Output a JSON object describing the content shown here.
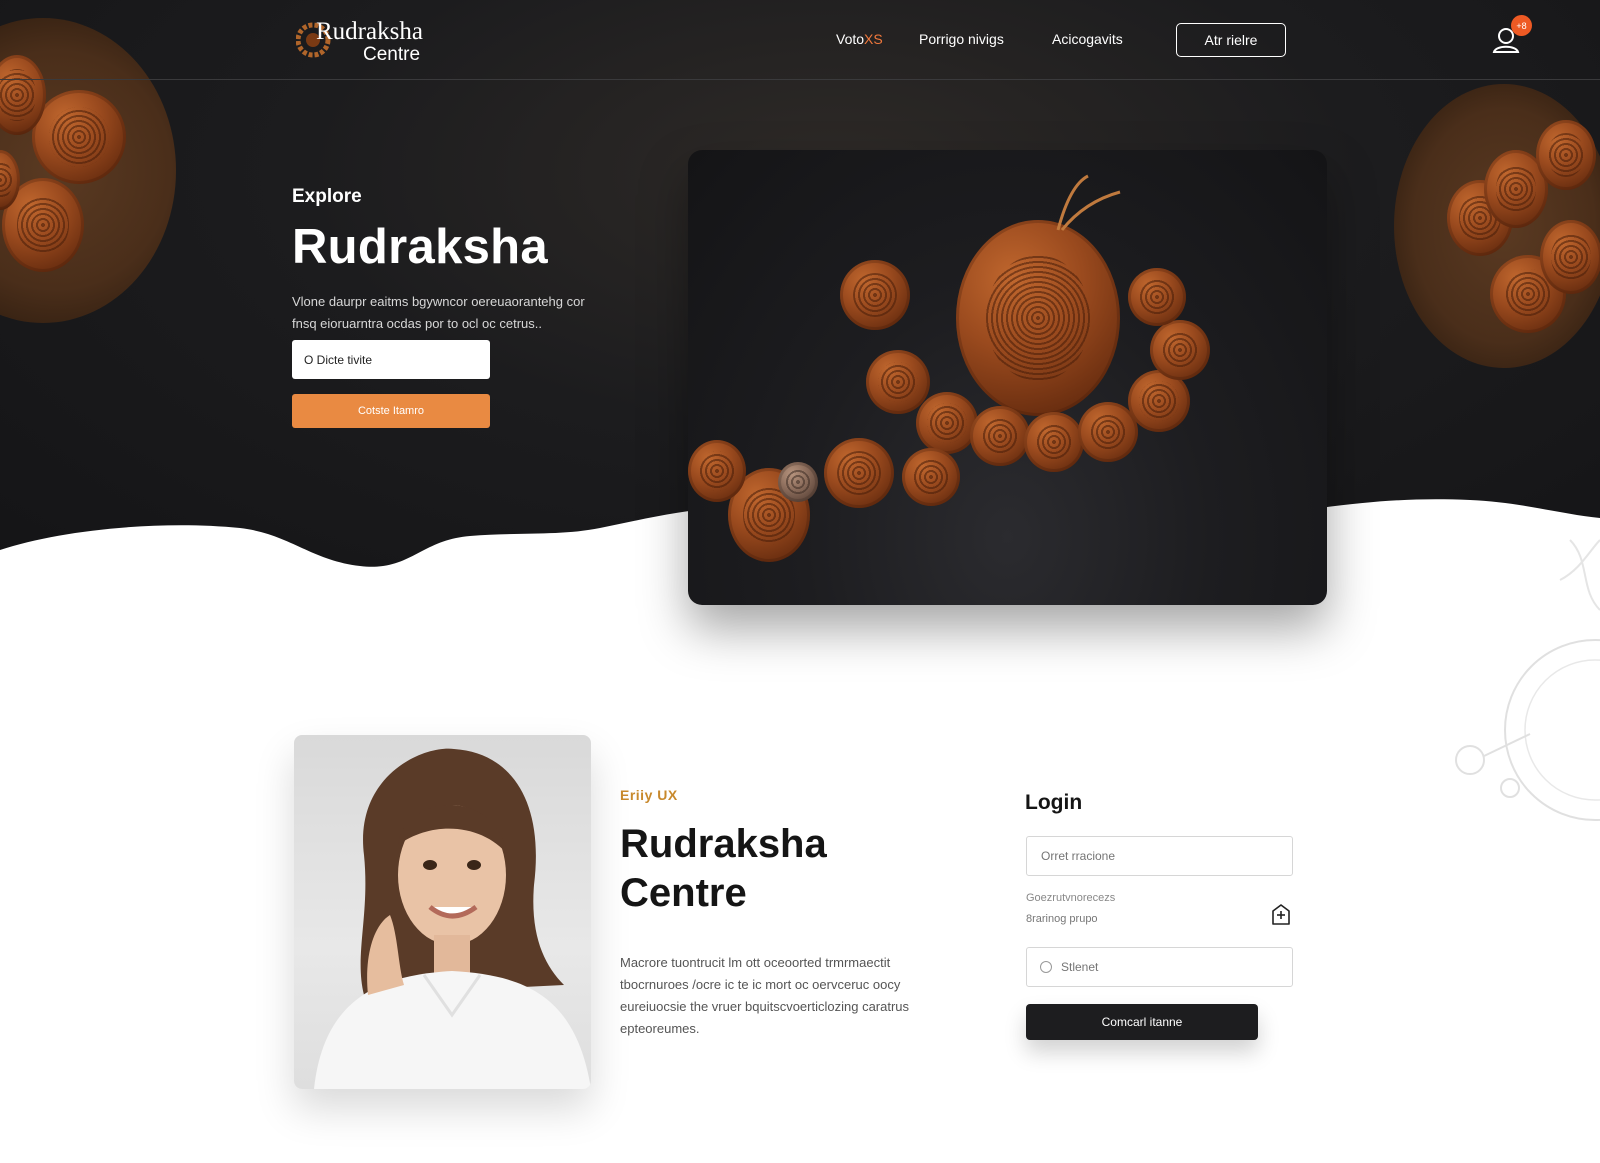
{
  "brand": {
    "title": "Rudraksha",
    "subtitle": "Centre"
  },
  "nav": {
    "links": [
      {
        "label_main": "Voto",
        "label_accent": "XS"
      },
      {
        "label_main": "Porrigo nivigs",
        "label_accent": ""
      },
      {
        "label_main": "Acicogavits",
        "label_accent": ""
      }
    ],
    "button_label": "Atr rielre",
    "notification_count": "+8"
  },
  "hero": {
    "eyebrow": "Explore",
    "title": "Rudraksha",
    "description": "Vlone daurpr eaitms bgywncor oereuaorantehg cor fnsq eioruarntra ocdas por to ocl oc cetrus..",
    "input_value": "O Dicte tivite",
    "cta_label": "Cotste Itamro"
  },
  "about": {
    "eyebrow": "Eriiy UX",
    "title_line1": "Rudraksha",
    "title_line2": "Centre",
    "description": "Macrore tuontrucit lm ott oceoorted trmrmaectit tbocrnuroes /ocre ic te ic mort oc oervceruc oocy eureiuocsie the vruer bquitscvoerticlozing caratrus epteoreumes."
  },
  "login": {
    "title": "Login",
    "email_placeholder": "Orret rracione",
    "forgot_text": "Goezrutvnorecezs",
    "hint_text": "8rarinog prupo",
    "password_placeholder": "Stlenet",
    "submit_label": "Comcarl itanne"
  },
  "colors": {
    "accent_orange": "#e98a42",
    "hero_dark": "#1c1c1e",
    "eyebrow_gold": "#c8892c",
    "badge_red": "#ee5a24",
    "button_dark": "#1d1d1f"
  },
  "icons": {
    "user": "user-icon",
    "add": "add-square-icon",
    "logo": "rudraksha-bead-logo-icon",
    "password": "lock-icon"
  }
}
